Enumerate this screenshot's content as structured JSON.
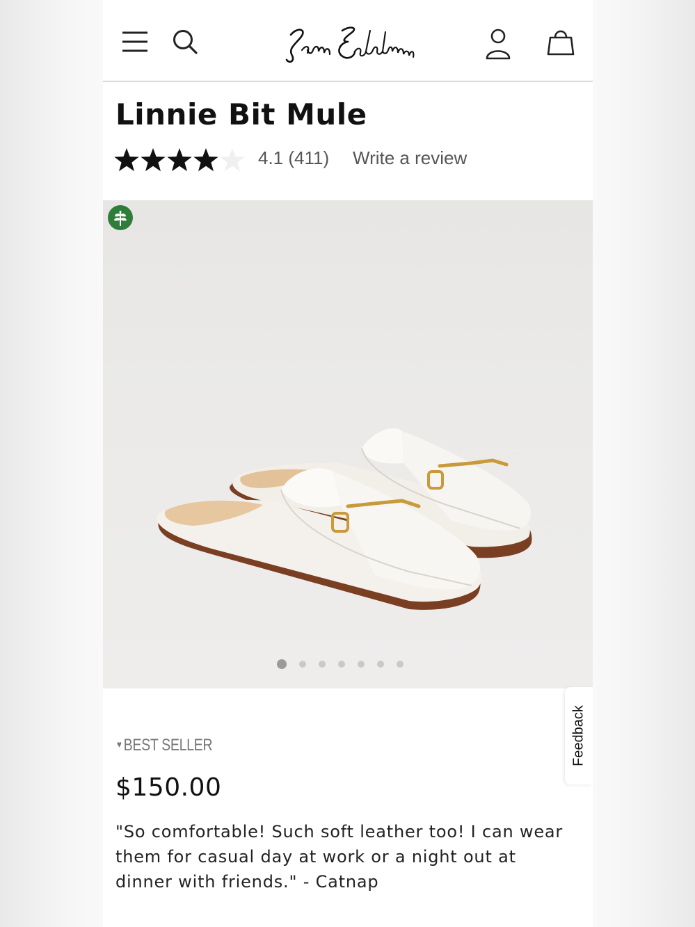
{
  "header": {
    "brand": "Sam Edelman",
    "icons": [
      "menu-icon",
      "search-icon",
      "account-icon",
      "bag-icon"
    ]
  },
  "product": {
    "title": "Linnie Bit Mule",
    "rating_value": 4.1,
    "rating_text": "4.1 (411)",
    "review_link": "Write a review",
    "badge": "BEST SELLER",
    "price": "$150.00",
    "quote": "\"So comfortable! Such soft leather too! I can wear them for casual day at work or a night out at dinner with friends.\" - Catnap"
  },
  "gallery": {
    "image_count": 7,
    "active_index": 0,
    "eco_icon": "leaf-icon"
  },
  "feedback_tab": "Feedback",
  "colors": {
    "eco_green": "#2f7d3b",
    "text": "#111111",
    "muted": "#555555"
  }
}
